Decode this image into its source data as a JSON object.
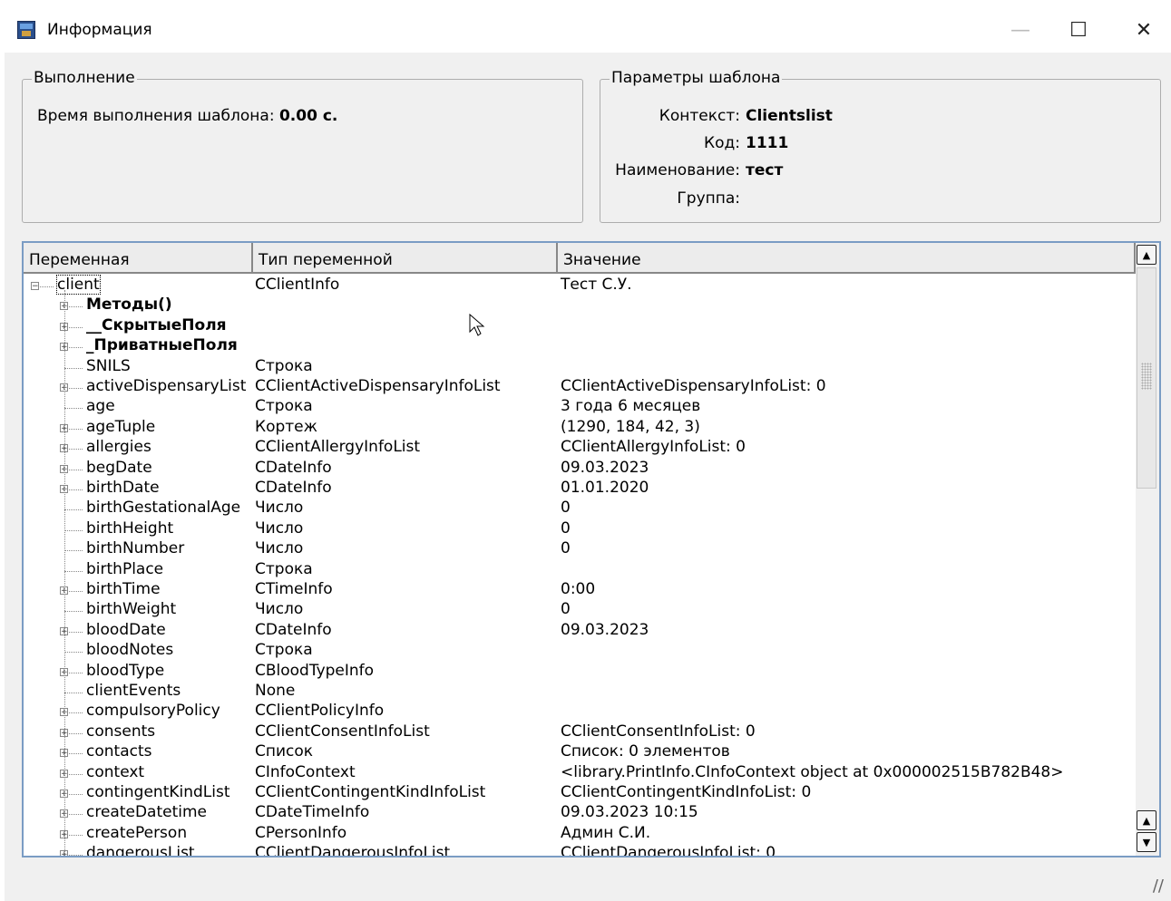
{
  "window": {
    "title": "Информация",
    "controls": {
      "minimize": "—",
      "maximize": "☐",
      "close": "✕"
    }
  },
  "execution": {
    "title": "Выполнение",
    "time_label": "Время выполнения шаблона:",
    "time_value": "0.00 с."
  },
  "template_params": {
    "title": "Параметры шаблона",
    "rows": [
      {
        "label": "Контекст:",
        "value": "Clientslist"
      },
      {
        "label": "Код:",
        "value": "1111"
      },
      {
        "label": "Наименование:",
        "value": "тест"
      },
      {
        "label": "Группа:",
        "value": ""
      }
    ]
  },
  "table": {
    "columns": [
      "Переменная",
      "Тип переменной",
      "Значение"
    ],
    "rows": [
      {
        "name": "client",
        "type": "CClientInfo",
        "value": "Тест С.У.",
        "level": 0,
        "expander": "minus",
        "bold": false
      },
      {
        "name": "Методы()",
        "type": "",
        "value": "",
        "level": 1,
        "expander": "plus",
        "bold": true
      },
      {
        "name": "__СкрытыеПоля",
        "type": "",
        "value": "",
        "level": 1,
        "expander": "plus",
        "bold": true
      },
      {
        "name": "_ПриватныеПоля",
        "type": "",
        "value": "",
        "level": 1,
        "expander": "plus",
        "bold": true
      },
      {
        "name": "SNILS",
        "type": "Строка",
        "value": "",
        "level": 1,
        "expander": "none",
        "bold": false
      },
      {
        "name": "activeDispensaryList",
        "type": "CClientActiveDispensaryInfoList",
        "value": "CClientActiveDispensaryInfoList: 0",
        "level": 1,
        "expander": "plus",
        "bold": false
      },
      {
        "name": "age",
        "type": "Строка",
        "value": "3 года 6 месяцев",
        "level": 1,
        "expander": "none",
        "bold": false
      },
      {
        "name": "ageTuple",
        "type": "Кортеж",
        "value": "(1290, 184, 42, 3)",
        "level": 1,
        "expander": "plus",
        "bold": false
      },
      {
        "name": "allergies",
        "type": "CClientAllergyInfoList",
        "value": "CClientAllergyInfoList: 0",
        "level": 1,
        "expander": "plus",
        "bold": false
      },
      {
        "name": "begDate",
        "type": "CDateInfo",
        "value": "09.03.2023",
        "level": 1,
        "expander": "plus",
        "bold": false
      },
      {
        "name": "birthDate",
        "type": "CDateInfo",
        "value": "01.01.2020",
        "level": 1,
        "expander": "plus",
        "bold": false
      },
      {
        "name": "birthGestationalAge",
        "type": "Число",
        "value": "0",
        "level": 1,
        "expander": "none",
        "bold": false
      },
      {
        "name": "birthHeight",
        "type": "Число",
        "value": "0",
        "level": 1,
        "expander": "none",
        "bold": false
      },
      {
        "name": "birthNumber",
        "type": "Число",
        "value": "0",
        "level": 1,
        "expander": "none",
        "bold": false
      },
      {
        "name": "birthPlace",
        "type": "Строка",
        "value": "",
        "level": 1,
        "expander": "none",
        "bold": false
      },
      {
        "name": "birthTime",
        "type": "CTimeInfo",
        "value": "0:00",
        "level": 1,
        "expander": "plus",
        "bold": false
      },
      {
        "name": "birthWeight",
        "type": "Число",
        "value": "0",
        "level": 1,
        "expander": "none",
        "bold": false
      },
      {
        "name": "bloodDate",
        "type": "CDateInfo",
        "value": "09.03.2023",
        "level": 1,
        "expander": "plus",
        "bold": false
      },
      {
        "name": "bloodNotes",
        "type": "Строка",
        "value": "",
        "level": 1,
        "expander": "none",
        "bold": false
      },
      {
        "name": "bloodType",
        "type": "CBloodTypeInfo",
        "value": "",
        "level": 1,
        "expander": "plus",
        "bold": false
      },
      {
        "name": "clientEvents",
        "type": "None",
        "value": "",
        "level": 1,
        "expander": "none",
        "bold": false
      },
      {
        "name": "compulsoryPolicy",
        "type": "CClientPolicyInfo",
        "value": "",
        "level": 1,
        "expander": "plus",
        "bold": false
      },
      {
        "name": "consents",
        "type": "CClientConsentInfoList",
        "value": "CClientConsentInfoList: 0",
        "level": 1,
        "expander": "plus",
        "bold": false
      },
      {
        "name": "contacts",
        "type": "Список",
        "value": "Список: 0 элементов",
        "level": 1,
        "expander": "plus",
        "bold": false
      },
      {
        "name": "context",
        "type": "CInfoContext",
        "value": "<library.PrintInfo.CInfoContext object at 0x000002515B782B48>",
        "level": 1,
        "expander": "plus",
        "bold": false
      },
      {
        "name": "contingentKindList",
        "type": "CClientContingentKindInfoList",
        "value": "CClientContingentKindInfoList: 0",
        "level": 1,
        "expander": "plus",
        "bold": false
      },
      {
        "name": "createDatetime",
        "type": "CDateTimeInfo",
        "value": "09.03.2023 10:15",
        "level": 1,
        "expander": "plus",
        "bold": false
      },
      {
        "name": "createPerson",
        "type": "CPersonInfo",
        "value": "Админ С.И.",
        "level": 1,
        "expander": "plus",
        "bold": false
      },
      {
        "name": "dangerousList",
        "type": "CClientDangerousInfoList",
        "value": "CClientDangerousInfoList: 0",
        "level": 1,
        "expander": "plus",
        "bold": false
      }
    ]
  },
  "scrollbar": {
    "up": "▲",
    "down": "▼"
  },
  "resize_grip": "//"
}
